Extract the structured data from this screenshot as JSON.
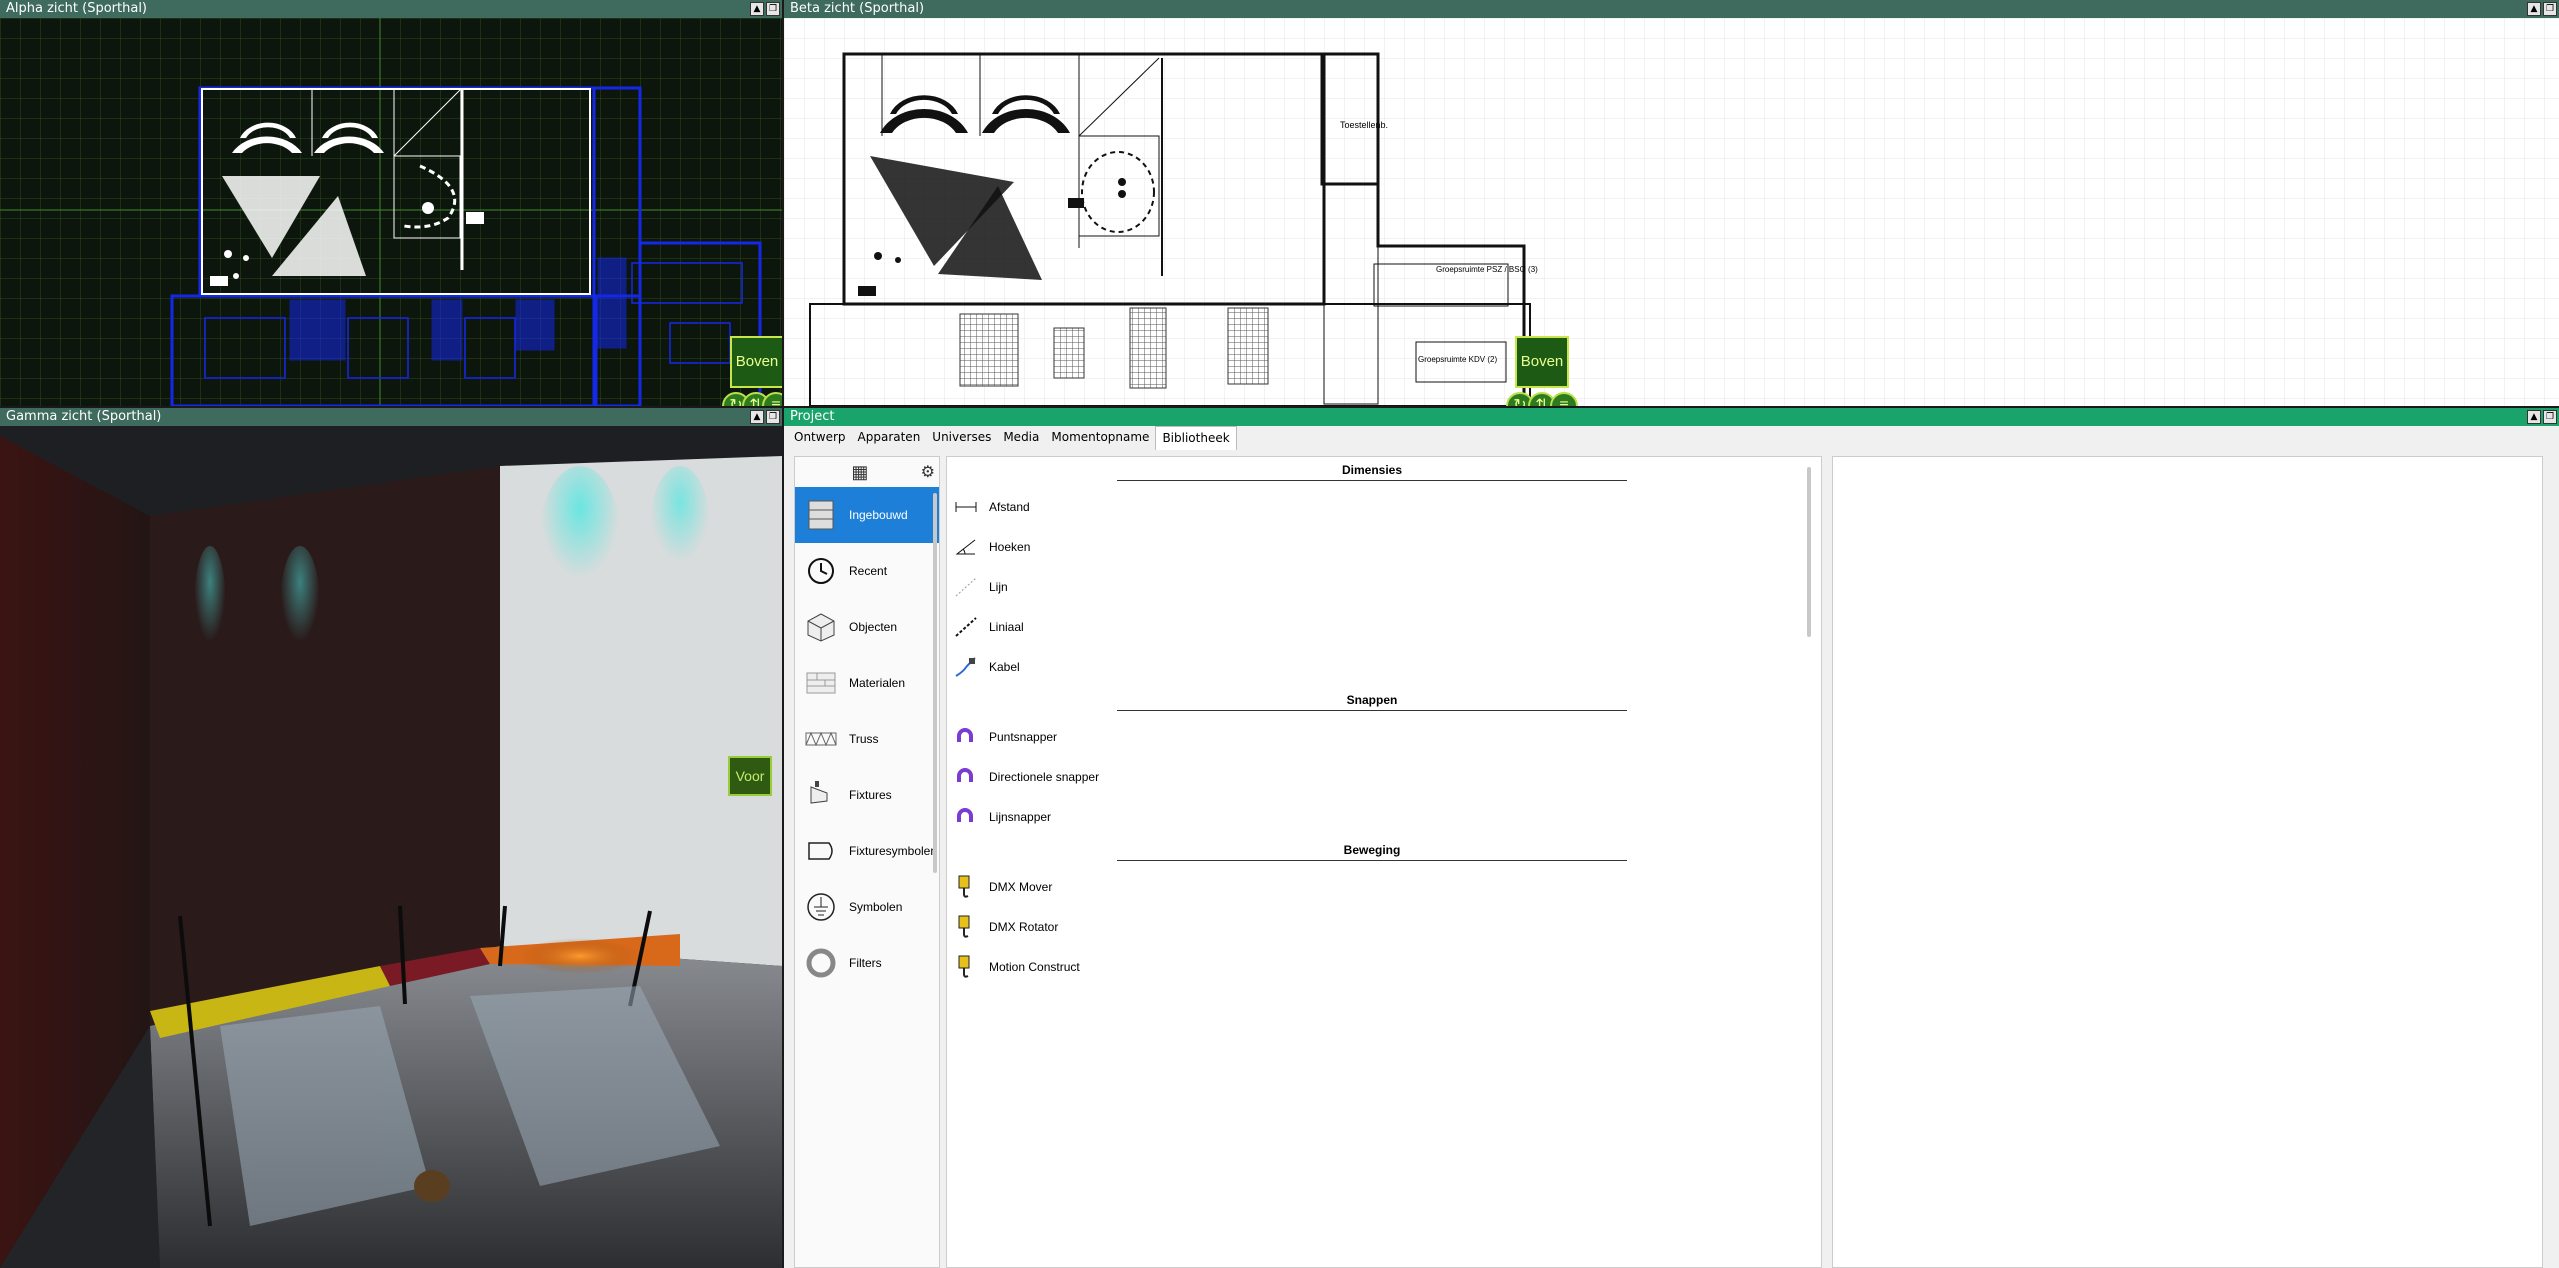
{
  "alpha": {
    "title": "Alpha zicht  (Sporthal)",
    "view_label": "Boven"
  },
  "beta": {
    "title": "Beta zicht  (Sporthal)",
    "view_label": "Boven",
    "labels": [
      "Toestellenb.",
      "Groepsruimte\nPSZ / BSO\n(3)",
      "Groepsruimte\nKDV\n(2)"
    ]
  },
  "gamma": {
    "title": "Gamma zicht  (Sporthal)",
    "view_label": "Voor"
  },
  "project": {
    "title": "Project",
    "tabs": [
      "Ontwerp",
      "Apparaten",
      "Universes",
      "Media",
      "Momentopname",
      "Bibliotheek"
    ],
    "active_tab": "Bibliotheek",
    "categories": [
      {
        "label": "Ingebouwd",
        "icon": "cabinet-icon",
        "active": true
      },
      {
        "label": "Recent",
        "icon": "clock-icon"
      },
      {
        "label": "Objecten",
        "icon": "cube-icon"
      },
      {
        "label": "Materialen",
        "icon": "brick-icon"
      },
      {
        "label": "Truss",
        "icon": "truss-icon"
      },
      {
        "label": "Fixtures",
        "icon": "spotlight-icon"
      },
      {
        "label": "Fixturesymbolen",
        "icon": "fixture-symbol-icon"
      },
      {
        "label": "Symbolen",
        "icon": "ground-symbol-icon"
      },
      {
        "label": "Filters",
        "icon": "filter-icon"
      }
    ],
    "sections": [
      {
        "title": "Dimensies",
        "items": [
          {
            "label": "Afstand",
            "icon": "distance-icon"
          },
          {
            "label": "Hoeken",
            "icon": "angle-icon"
          },
          {
            "label": "Lijn",
            "icon": "line-icon"
          },
          {
            "label": "Liniaal",
            "icon": "ruler-icon"
          },
          {
            "label": "Kabel",
            "icon": "cable-icon"
          }
        ]
      },
      {
        "title": "Snappen",
        "items": [
          {
            "label": "Puntsnapper",
            "icon": "magnet-icon"
          },
          {
            "label": "Directionele snapper",
            "icon": "magnet-icon"
          },
          {
            "label": "Lijnsnapper",
            "icon": "magnet-icon"
          }
        ]
      },
      {
        "title": "Beweging",
        "items": [
          {
            "label": "DMX Mover",
            "icon": "hoist-icon"
          },
          {
            "label": "DMX Rotator",
            "icon": "hoist-icon"
          },
          {
            "label": "Motion Construct",
            "icon": "hoist-icon"
          }
        ]
      }
    ]
  }
}
